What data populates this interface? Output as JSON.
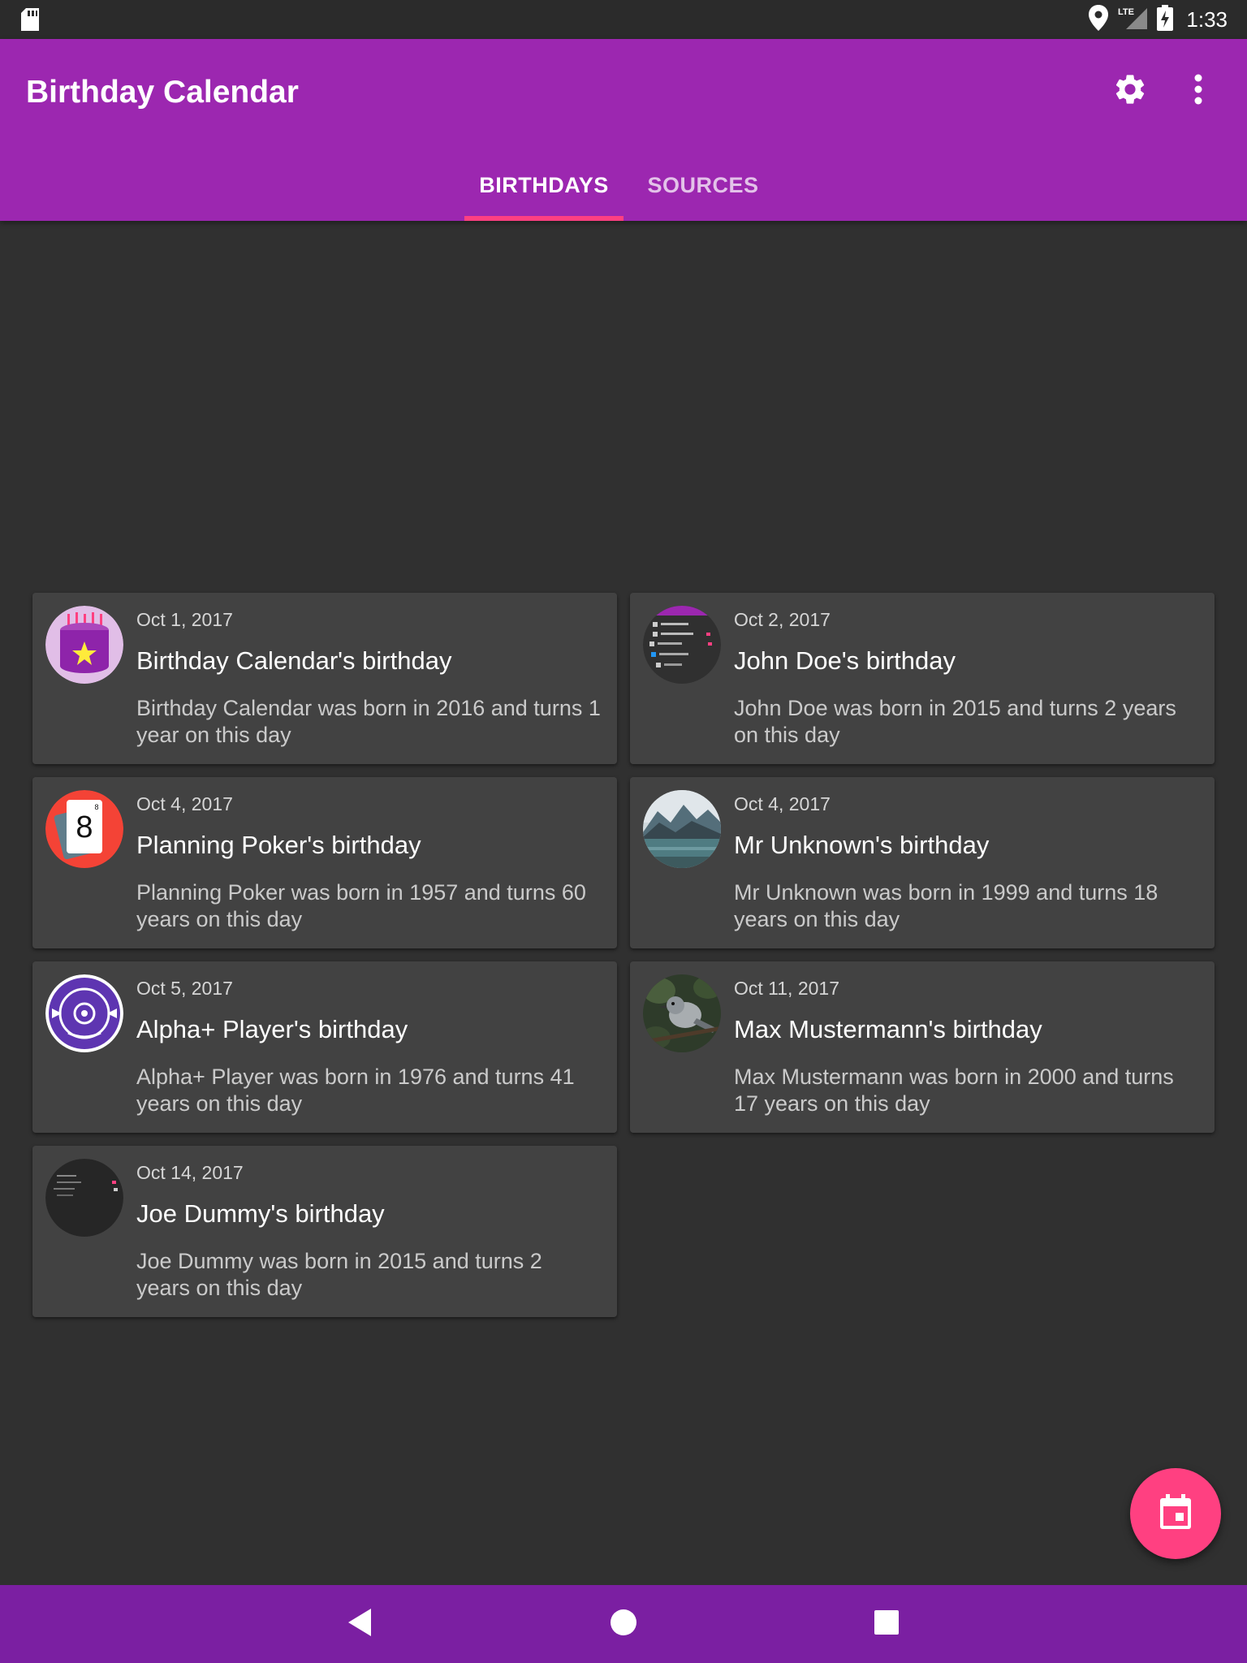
{
  "status_bar": {
    "time": "1:33",
    "network": "LTE",
    "icons": [
      "sd-card-icon",
      "location-icon",
      "signal-icon",
      "battery-charging-icon"
    ]
  },
  "app_bar": {
    "title": "Birthday Calendar",
    "actions": [
      "settings-icon",
      "more-vert-icon"
    ],
    "color": "#9c27b0"
  },
  "tabs": [
    {
      "label": "BIRTHDAYS",
      "selected": true
    },
    {
      "label": "SOURCES",
      "selected": false
    }
  ],
  "accent_color": "#ff4081",
  "birthdays": [
    {
      "date": "Oct 1, 2017",
      "title": "Birthday Calendar's birthday",
      "text": "Birthday Calendar was born in 2016 and turns 1 year on this day",
      "avatar": "cake-avatar"
    },
    {
      "date": "Oct 2, 2017",
      "title": "John Doe's birthday",
      "text": "John Doe was born in 2015 and turns 2 years on this day",
      "avatar": "screenshot-avatar"
    },
    {
      "date": "Oct 4, 2017",
      "title": "Planning Poker's birthday",
      "text": "Planning Poker was born in 1957 and turns 60 years on this day",
      "avatar": "poker-card-avatar",
      "avatar_text": "8"
    },
    {
      "date": "Oct 4, 2017",
      "title": "Mr Unknown's birthday",
      "text": "Mr Unknown was born in 1999 and turns 18 years on this day",
      "avatar": "mountain-lake-avatar"
    },
    {
      "date": "Oct 5, 2017",
      "title": "Alpha+ Player's birthday",
      "text": "Alpha+ Player was born in 1976 and turns 41 years on this day",
      "avatar": "disc-player-avatar"
    },
    {
      "date": "Oct 11, 2017",
      "title": "Max Mustermann's birthday",
      "text": "Max Mustermann was born in 2000 and turns 17 years on this day",
      "avatar": "bird-avatar"
    },
    {
      "date": "Oct 14, 2017",
      "title": "Joe Dummy's birthday",
      "text": "Joe Dummy was born in 2015 and turns 2 years on this day",
      "avatar": "dark-screenshot-avatar"
    }
  ],
  "fab": {
    "icon": "calendar-event-icon"
  },
  "nav_bar": {
    "buttons": [
      "back-icon",
      "home-icon",
      "recents-icon"
    ],
    "color": "#7b1fa2"
  }
}
